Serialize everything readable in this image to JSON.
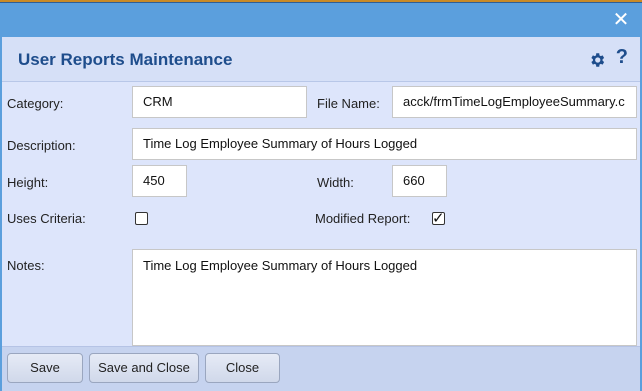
{
  "dialog": {
    "title": "User Reports Maintenance",
    "close_icon": "close-icon",
    "settings_icon": "gear-icon",
    "help_label": "?"
  },
  "form": {
    "category_label": "Category:",
    "category_value": "CRM",
    "file_name_label": "File Name:",
    "file_name_value": "acck/frmTimeLogEmployeeSummary.c",
    "description_label": "Description:",
    "description_value": "Time Log Employee Summary of Hours Logged",
    "height_label": "Height:",
    "height_value": "450",
    "width_label": "Width:",
    "width_value": "660",
    "uses_criteria_label": "Uses Criteria:",
    "uses_criteria_checked": false,
    "modified_report_label": "Modified Report:",
    "modified_report_checked": true,
    "notes_label": "Notes:",
    "notes_value": "Time Log Employee Summary of Hours Logged"
  },
  "footer": {
    "save_label": "Save",
    "save_close_label": "Save and Close",
    "close_label": "Close"
  },
  "colors": {
    "title_blue": "#1e4d8c",
    "window_blue": "#5b9fdd",
    "form_bg": "#dde5fb"
  }
}
